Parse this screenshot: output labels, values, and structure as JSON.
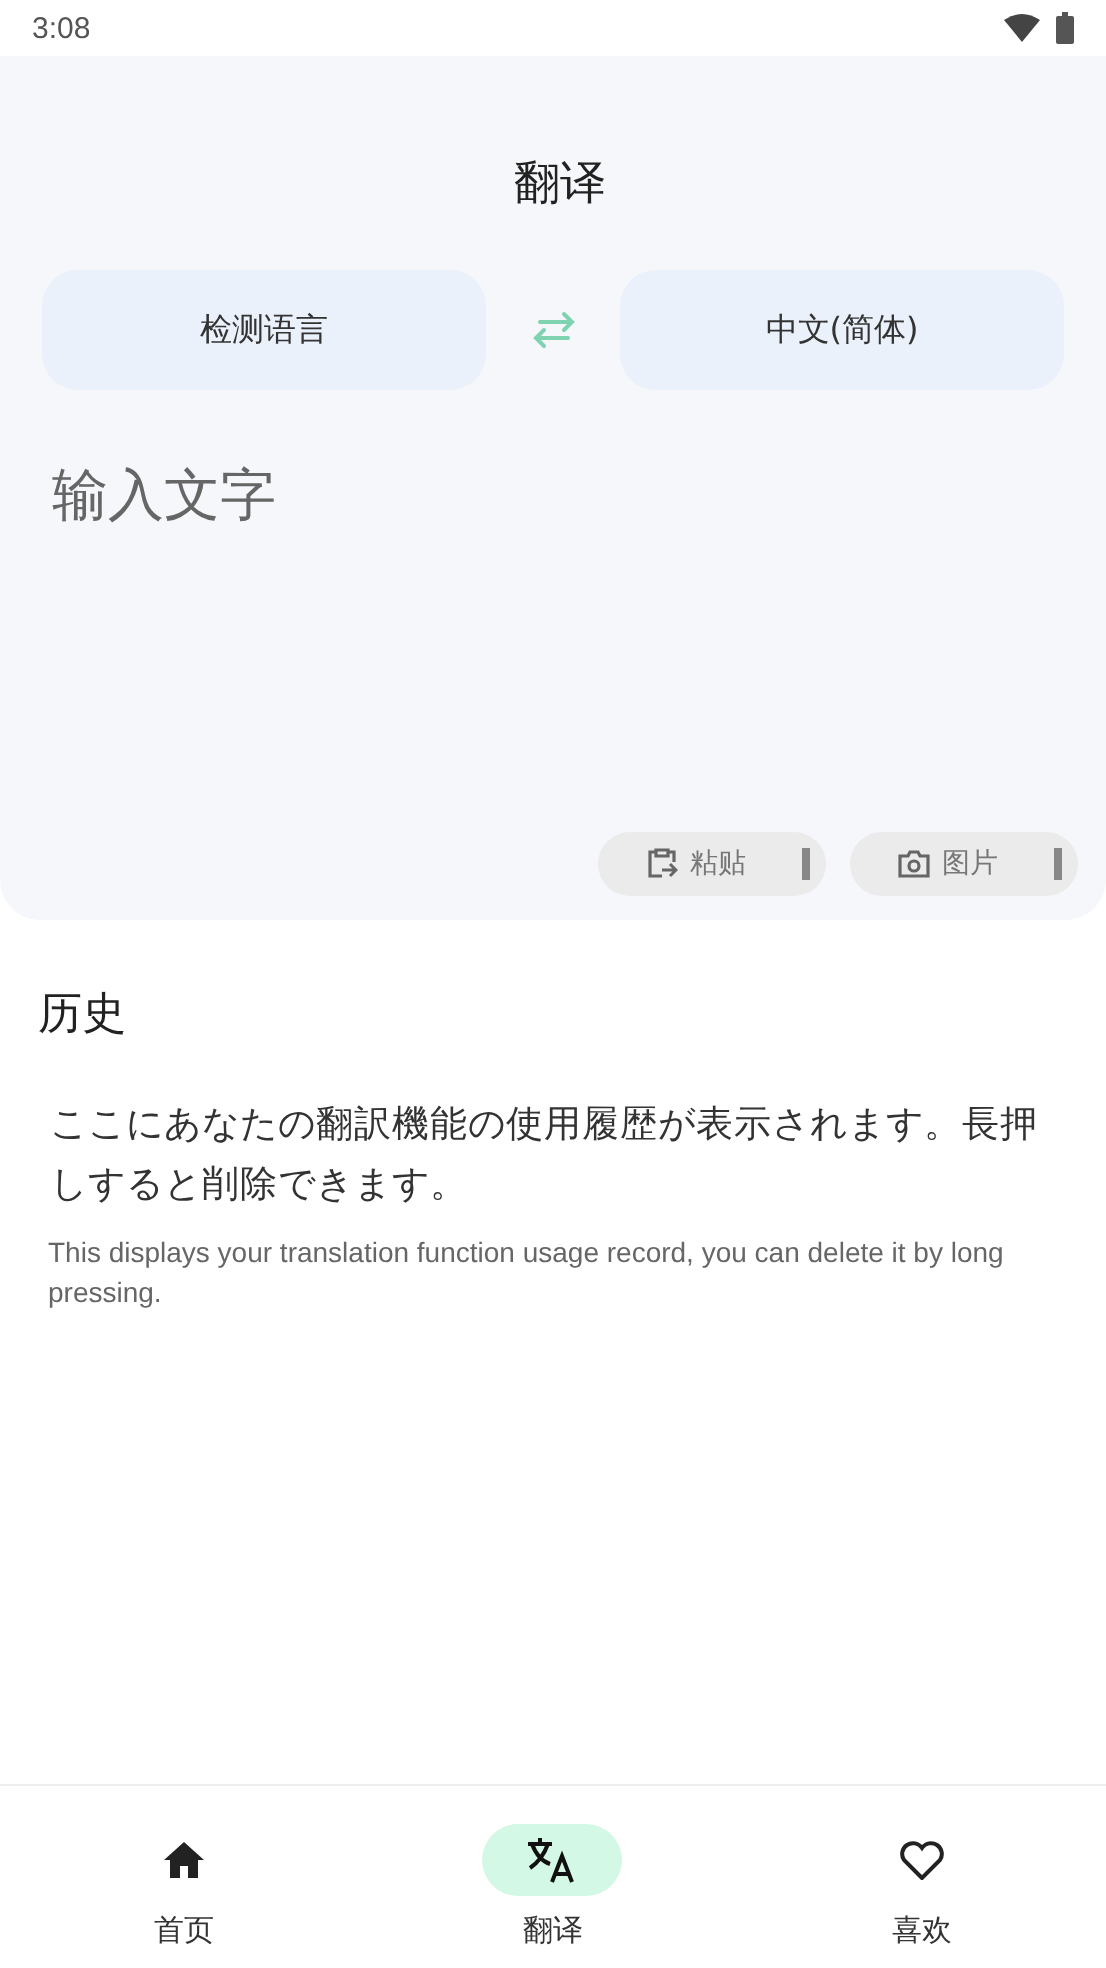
{
  "status_bar": {
    "time": "3:08"
  },
  "title": "翻译",
  "languages": {
    "source": "检测语言",
    "target": "中文(简体)"
  },
  "input": {
    "placeholder": "输入文字"
  },
  "input_actions": [
    {
      "kind": "paste",
      "label": "粘贴"
    },
    {
      "kind": "image",
      "label": "图片"
    }
  ],
  "history": {
    "title": "历史",
    "message": "ここにあなたの翻訳機能の使用履歴が表示されます。長押しすると削除できます。",
    "message_en": "This displays your translation function usage record, you can delete it by long pressing."
  },
  "nav": [
    {
      "kind": "home",
      "label": "首页",
      "selected": false
    },
    {
      "kind": "translate",
      "label": "翻译",
      "selected": true
    },
    {
      "kind": "favorite",
      "label": "喜欢",
      "selected": false
    }
  ]
}
